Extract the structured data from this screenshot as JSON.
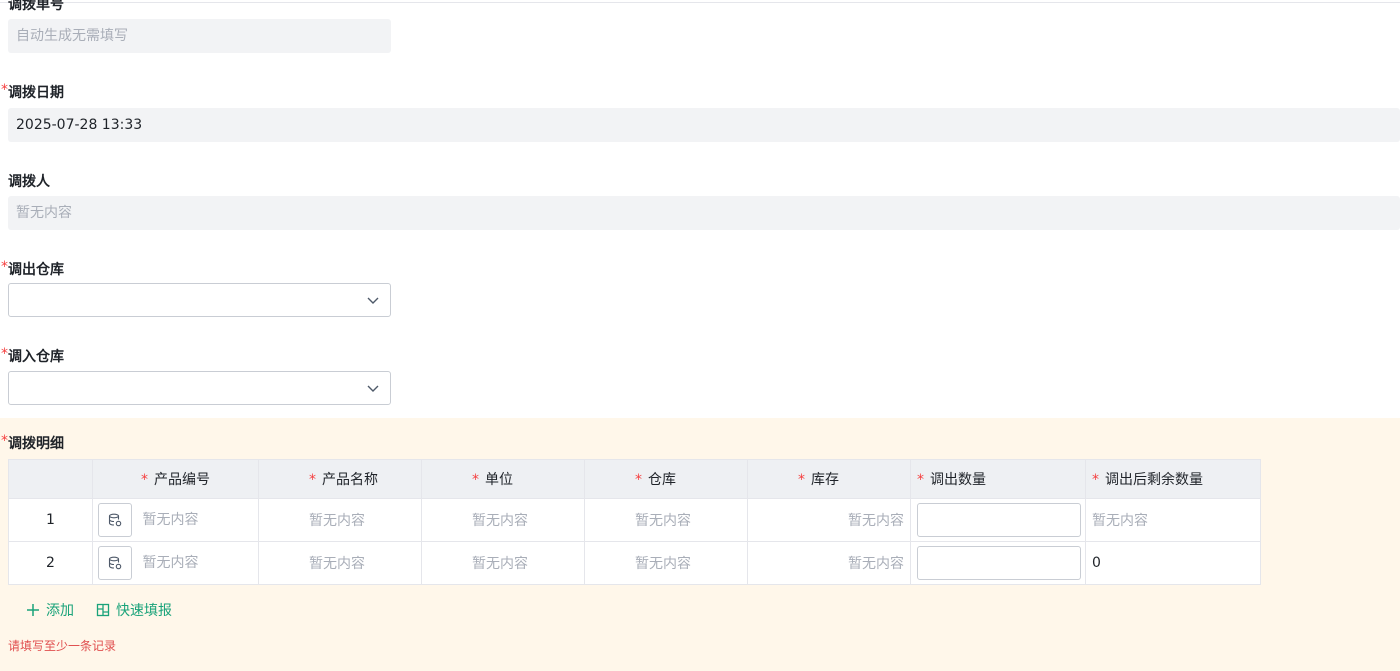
{
  "form": {
    "order_no": {
      "label": "调拨单号",
      "placeholder": "自动生成无需填写"
    },
    "date": {
      "label": "调拨日期",
      "required": "*",
      "value": "2025-07-28 13:33"
    },
    "person": {
      "label": "调拨人",
      "placeholder": "暂无内容"
    },
    "out_warehouse": {
      "label": "调出仓库",
      "required": "*",
      "value": ""
    },
    "in_warehouse": {
      "label": "调入仓库",
      "required": "*",
      "value": ""
    },
    "detail": {
      "label": "调拨明细",
      "required": "*"
    }
  },
  "table": {
    "columns": [
      "产品编号",
      "产品名称",
      "单位",
      "仓库",
      "库存",
      "调出数量",
      "调出后剩余数量"
    ],
    "required_mark": "*",
    "rows": [
      {
        "index": "1",
        "code": "暂无内容",
        "name": "暂无内容",
        "unit": "暂无内容",
        "warehouse": "暂无内容",
        "stock": "暂无内容",
        "qty": "",
        "remain": "暂无内容"
      },
      {
        "index": "2",
        "code": "暂无内容",
        "name": "暂无内容",
        "unit": "暂无内容",
        "warehouse": "暂无内容",
        "stock": "暂无内容",
        "qty": "",
        "remain": "0"
      }
    ]
  },
  "actions": {
    "add": "添加",
    "quick_fill": "快速填报"
  },
  "validation": {
    "message": "请填写至少一条记录"
  },
  "colors": {
    "accent": "#1aa37a",
    "required": "#f53f3f",
    "section_bg": "#fff7ea"
  }
}
